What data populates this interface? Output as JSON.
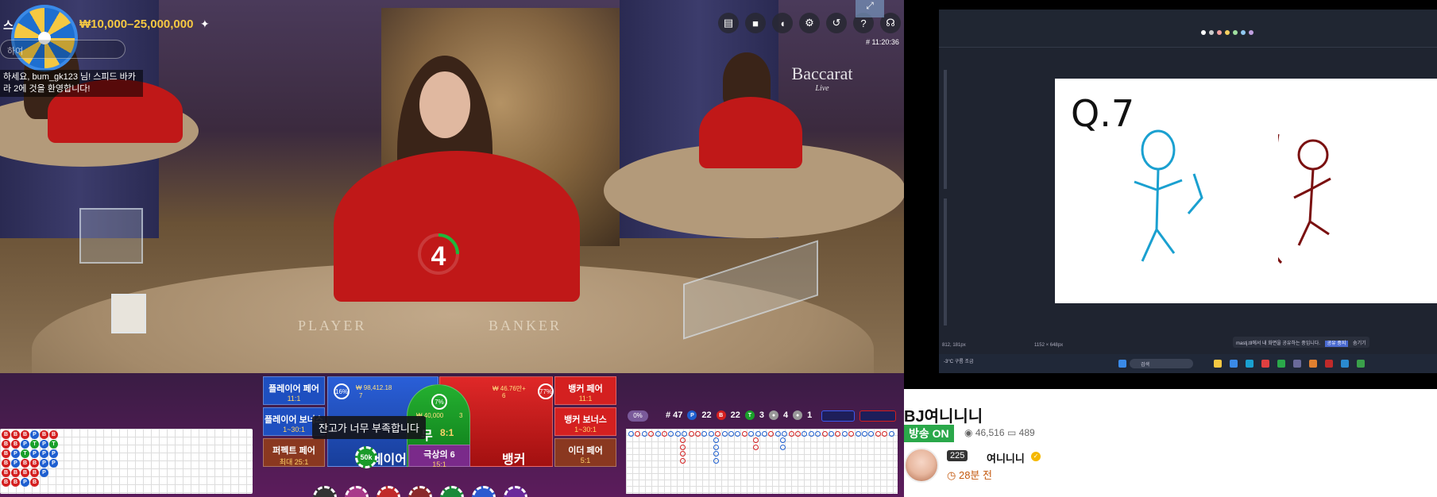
{
  "game": {
    "title_partial": "스",
    "bet_limits": "₩10,000–25,000,000",
    "chat_placeholder": "하여",
    "welcome_message": "하세요, bum_gk123 님! 스피드 바카라 2에 것을 환영합니다!",
    "clock": "# 11:20:36",
    "countdown": "4",
    "table_labels": [
      "PLAYER",
      "BANKER"
    ],
    "logo_text": "Baccarat",
    "logo_sub": "Live",
    "controls": [
      "chat-icon",
      "camera-icon",
      "volume-icon",
      "gear-icon",
      "history-icon",
      "help-icon",
      "headset-icon"
    ],
    "fullscreen_icon": "expand-icon",
    "tooltip": "잔고가 너무 부족합니다",
    "bets": {
      "player_pair": {
        "label": "플레이어 페어",
        "odds": "11:1"
      },
      "player_bonus": {
        "label": "플레이어 보너스",
        "odds": "1~30:1"
      },
      "perfect_pair": {
        "label": "퍼펙트 페어",
        "odds": "최대 25:1"
      },
      "player": {
        "label": "플레이어",
        "amount": "₩ 98,412.18",
        "count": "7",
        "pct": "16%"
      },
      "tie": {
        "label": "무",
        "odds": "8:1",
        "amount": "₩ 40,000",
        "count": "3",
        "pct": "7%"
      },
      "banker": {
        "label": "뱅커",
        "amount": "₩ 46.76만+",
        "count": "6",
        "pct": "77%"
      },
      "super6": {
        "label": "극상의 6",
        "odds": "15:1"
      },
      "banker_pair": {
        "label": "뱅커 페어",
        "odds": "11:1"
      },
      "banker_bonus": {
        "label": "뱅커 보너스",
        "odds": "1~30:1"
      },
      "either_pair": {
        "label": "이더 페어",
        "odds": "5:1"
      }
    },
    "chip_value": "50k",
    "stats": {
      "pct": "0%",
      "total": "# 47",
      "player": "22",
      "banker": "22",
      "tie": "3",
      "player_pair": "4",
      "banker_pair": "1"
    },
    "bead_road": [
      [
        "B",
        "B",
        "B",
        "P",
        "B",
        "B",
        ""
      ],
      [
        "B",
        "B",
        "P",
        "T",
        "P",
        "T",
        ""
      ],
      [
        "B",
        "P",
        "T",
        "P",
        "P",
        "P",
        ""
      ],
      [
        "B",
        "P",
        "B",
        "B",
        "P",
        "P",
        ""
      ],
      [
        "B",
        "B",
        "B",
        "B",
        "P",
        "",
        ""
      ],
      [
        "B",
        "B",
        "P",
        "B",
        "",
        "",
        ""
      ]
    ],
    "colors": {
      "player": "#1e5fd0",
      "banker": "#d42020",
      "tie": "#1aa02a",
      "accent": "#f5c842"
    }
  },
  "stream": {
    "streamer_title": "BJ여니니니",
    "live_badge": "방송 ON",
    "viewers": "46,516",
    "comments": "489",
    "level": "225",
    "nickname": "여니니니",
    "ago": "28분 전",
    "canvas_text": "Q.7",
    "paint_status_left": "812, 181px",
    "paint_status_right": "1152 × 648px",
    "notice_text": "mastj.tll에서 내 화면을 공유하는 중입니다.",
    "notice_btn_stop": "공유 중지",
    "notice_btn_hide": "숨기기",
    "search_label": "검색",
    "weather": "-3°C 구름 조금"
  }
}
